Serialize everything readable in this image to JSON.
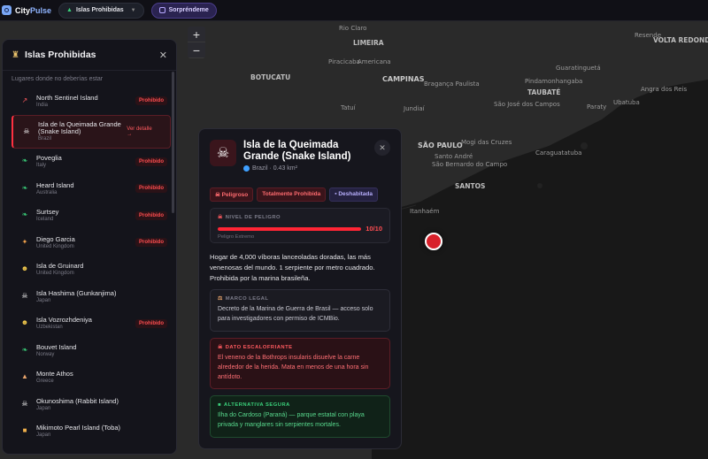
{
  "topbar": {
    "brand_part1": "City",
    "brand_part2": "Pulse",
    "category_dropdown": "Islas Prohibidas",
    "surprise_button": "Sorpréndeme"
  },
  "map": {
    "zoom_in": "+",
    "zoom_out": "−",
    "labels": [
      {
        "text": "Rio Claro",
        "cls": ""
      },
      {
        "text": "LIMEIRA",
        "cls": "bold"
      },
      {
        "text": "Piracicaba",
        "cls": ""
      },
      {
        "text": "Americana",
        "cls": ""
      },
      {
        "text": "BOTUCATU",
        "cls": "bold"
      },
      {
        "text": "CAMPINAS",
        "cls": "big"
      },
      {
        "text": "Bragança Paulista",
        "cls": ""
      },
      {
        "text": "Jundiaí",
        "cls": ""
      },
      {
        "text": "SÃO PAULO",
        "cls": "big"
      },
      {
        "text": "São Bernardo do Campo",
        "cls": ""
      },
      {
        "text": "Santo André",
        "cls": ""
      },
      {
        "text": "SANTOS",
        "cls": "bold"
      },
      {
        "text": "Mogi das Cruzes",
        "cls": ""
      },
      {
        "text": "São José dos Campos",
        "cls": ""
      },
      {
        "text": "Caraguatatuba",
        "cls": ""
      },
      {
        "text": "Guaratinguetá",
        "cls": ""
      },
      {
        "text": "Pindamonhangaba",
        "cls": ""
      },
      {
        "text": "TAUBATÉ",
        "cls": "bold"
      },
      {
        "text": "Angra dos Reis",
        "cls": ""
      },
      {
        "text": "Resende",
        "cls": ""
      },
      {
        "text": "VOLTA REDONDA",
        "cls": "bold"
      },
      {
        "text": "Itanhaém",
        "cls": ""
      },
      {
        "text": "Paraty",
        "cls": ""
      },
      {
        "text": "Tatuí",
        "cls": ""
      },
      {
        "text": "Ubatuba",
        "cls": ""
      }
    ]
  },
  "sidebar": {
    "title": "Islas Prohibidas",
    "subtitle": "Lugares donde no deberías estar",
    "items": [
      {
        "name": "North Sentinel Island",
        "country": "India",
        "tag": "Prohibido",
        "icon": "↗",
        "color": "#ff5a5f"
      },
      {
        "name": "Isla de la Queimada Grande (Snake Island)",
        "country": "Brazil",
        "tag": "Ver detalle →",
        "icon": "☠",
        "color": "#ffffff"
      },
      {
        "name": "Poveglia",
        "country": "Italy",
        "tag": "Prohibido",
        "icon": "❧",
        "color": "#3ad07a"
      },
      {
        "name": "Heard Island",
        "country": "Australia",
        "tag": "Prohibido",
        "icon": "❧",
        "color": "#3ad07a"
      },
      {
        "name": "Surtsey",
        "country": "Iceland",
        "tag": "Prohibido",
        "icon": "❧",
        "color": "#3ad07a"
      },
      {
        "name": "Diego Garcia",
        "country": "United Kingdom",
        "tag": "Prohibido",
        "icon": "✦",
        "color": "#f0a04b"
      },
      {
        "name": "Isla de Gruinard",
        "country": "United Kingdom",
        "tag": "",
        "icon": "☻",
        "color": "#f2c94c"
      },
      {
        "name": "Isla Hashima (Gunkanjima)",
        "country": "Japan",
        "tag": "",
        "icon": "☠",
        "color": "#ffffff"
      },
      {
        "name": "Isla Vozrozhdeniya",
        "country": "Uzbekistan",
        "tag": "Prohibido",
        "icon": "☻",
        "color": "#f2c94c"
      },
      {
        "name": "Bouvet Island",
        "country": "Norway",
        "tag": "",
        "icon": "❧",
        "color": "#3ad07a"
      },
      {
        "name": "Monte Athos",
        "country": "Greece",
        "tag": "",
        "icon": "▲",
        "color": "#e8a46b"
      },
      {
        "name": "Okunoshima (Rabbit Island)",
        "country": "Japan",
        "tag": "",
        "icon": "☠",
        "color": "#ffffff"
      },
      {
        "name": "Mikimoto Pearl Island (Toba)",
        "country": "Japan",
        "tag": "",
        "icon": "■",
        "color": "#f0b04b"
      }
    ]
  },
  "detail": {
    "title": "Isla de la Queimada Grande (Snake Island)",
    "meta": "Brazil · 0.43 km²",
    "close": "✕",
    "badges": [
      "Peligroso",
      "Totalmente Prohibida",
      "Deshabitada"
    ],
    "danger_label": "NIVEL DE PELIGRO",
    "danger_value": "10/10",
    "danger_level": 10,
    "danger_max": 10,
    "danger_text": "Peligro Extremo",
    "description": "Hogar de 4,000 víboras lanceoladas doradas, las más venenosas del mundo. 1 serpiente por metro cuadrado. Prohibida por la marina brasileña.",
    "legal_label": "MARCO LEGAL",
    "legal_text": "Decreto de la Marina de Guerra de Brasil — acceso solo para investigadores con permiso de ICMBio.",
    "fact_label": "DATO ESCALOFRIANTE",
    "fact_text": "El veneno de la Bothrops insularis disuelve la carne alrededor de la herida. Mata en menos de una hora sin antídoto.",
    "alt_label": "ALTERNATIVA SEGURA",
    "alt_text": "Ilha do Cardoso (Paraná) — parque estatal con playa privada y manglares sin serpientes mortales."
  },
  "colors": {
    "accent_red": "#ff2535",
    "brand_blue": "#8fb4ff",
    "safe_green": "#3ad07a",
    "surprise_purple": "#b7a8ff"
  }
}
